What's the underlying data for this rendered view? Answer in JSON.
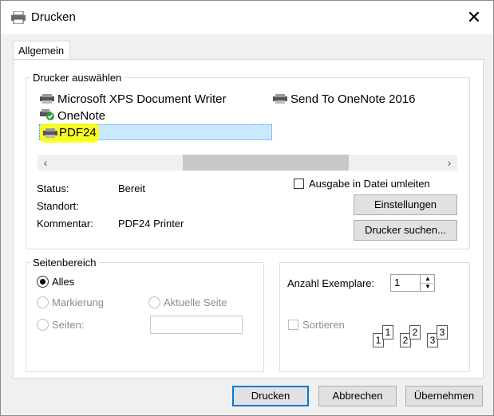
{
  "window": {
    "title": "Drucken"
  },
  "tabs": [
    {
      "label": "Allgemein"
    }
  ],
  "printer_group": {
    "legend": "Drucker auswählen",
    "printers": [
      {
        "name": "Microsoft XPS Document Writer"
      },
      {
        "name": "Send To OneNote 2016"
      },
      {
        "name": "OneNote"
      },
      {
        "name": "PDF24",
        "selected": true
      }
    ],
    "highlight_color": "#ffff00",
    "selection_color": "#cce8ff",
    "status_label": "Status:",
    "status_value": "Bereit",
    "location_label": "Standort:",
    "location_value": "",
    "comment_label": "Kommentar:",
    "comment_value": "PDF24 Printer",
    "print_to_file_label": "Ausgabe in Datei umleiten",
    "settings_button": "Einstellungen",
    "find_printer_button": "Drucker suchen..."
  },
  "page_range": {
    "legend": "Seitenbereich",
    "all_label": "Alles",
    "selection_label": "Markierung",
    "current_page_label": "Aktuelle Seite",
    "pages_label": "Seiten:",
    "pages_value": ""
  },
  "copies": {
    "label": "Anzahl Exemplare:",
    "value": "1",
    "collate_label": "Sortieren",
    "page_numbers": [
      "1",
      "1",
      "2",
      "2",
      "3",
      "3"
    ]
  },
  "footer": {
    "print_button": "Drucken",
    "cancel_button": "Abbrechen",
    "apply_button": "Übernehmen"
  }
}
